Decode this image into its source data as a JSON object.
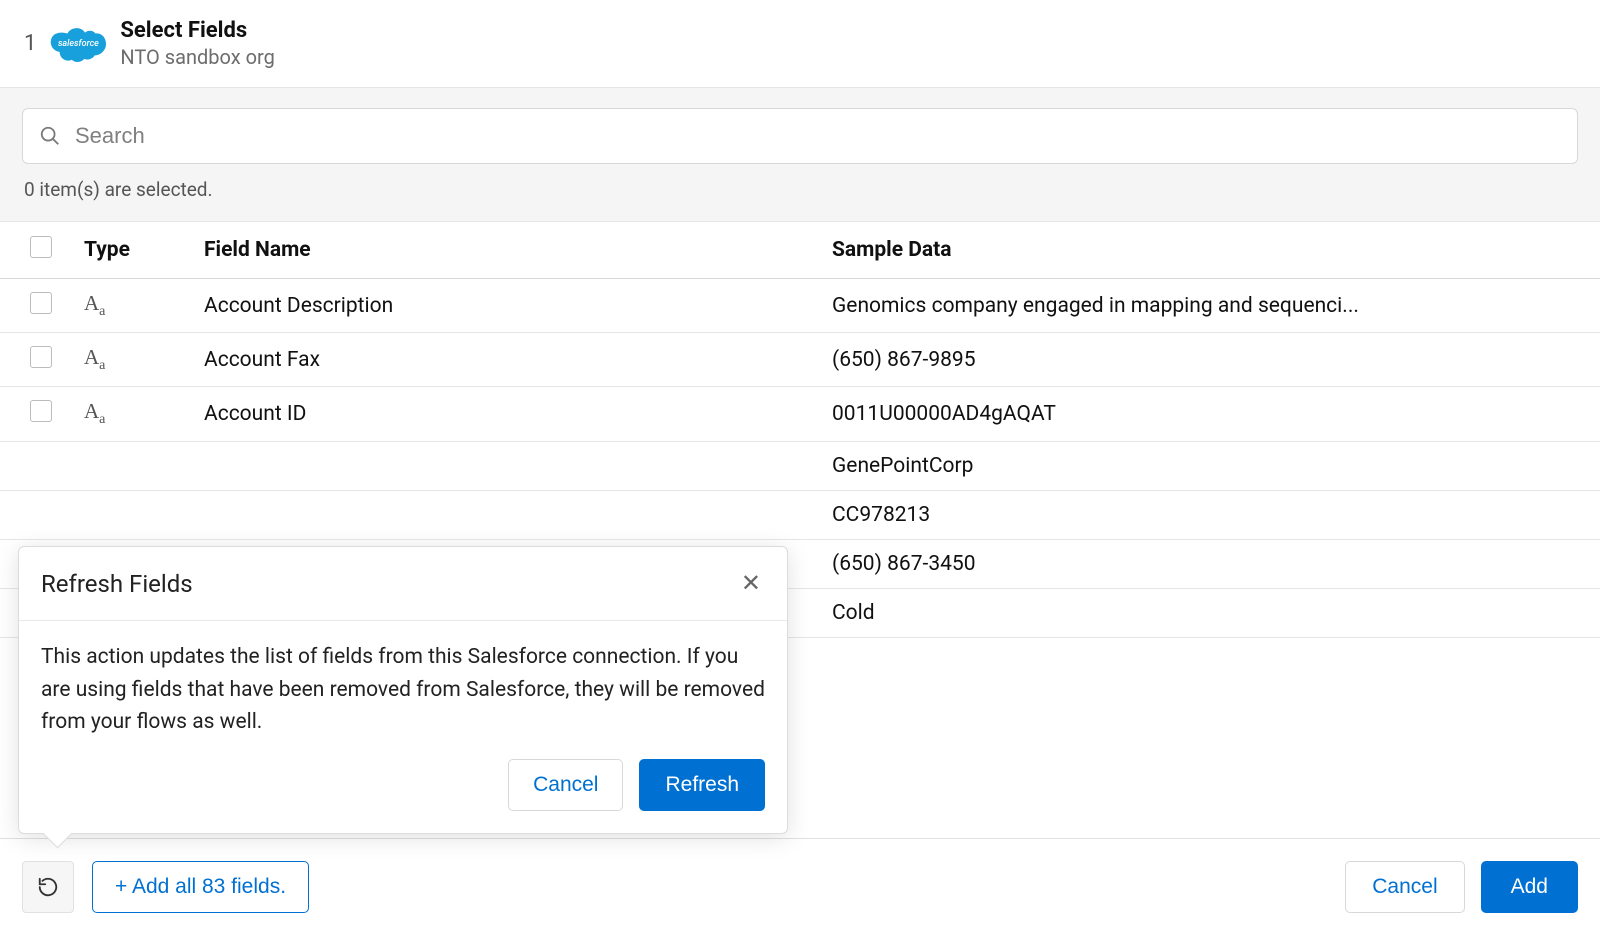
{
  "header": {
    "step_number": "1",
    "title": "Select Fields",
    "subtitle": "NTO sandbox org",
    "cloud_label": "salesforce"
  },
  "search": {
    "placeholder": "Search",
    "selected_text": "0 item(s) are selected."
  },
  "table": {
    "cols": {
      "type": "Type",
      "field_name": "Field Name",
      "sample": "Sample Data"
    },
    "rows": [
      {
        "name": "Account Description",
        "sample": "Genomics company engaged in mapping and sequenci..."
      },
      {
        "name": "Account Fax",
        "sample": "(650) 867-9895"
      },
      {
        "name": "Account ID",
        "sample": "0011U00000AD4gAQAT"
      },
      {
        "name": "",
        "sample": "GenePointCorp"
      },
      {
        "name": "",
        "sample": "CC978213"
      },
      {
        "name": "",
        "sample": "(650) 867-3450"
      },
      {
        "name": "",
        "sample": "Cold"
      }
    ]
  },
  "popover": {
    "title": "Refresh Fields",
    "body": "This action updates the list of fields from this Salesforce connection. If you are using fields that have been removed from Salesforce, they will be removed from your flows as well.",
    "cancel": "Cancel",
    "confirm": "Refresh"
  },
  "footer": {
    "add_all": "+ Add all 83 fields.",
    "cancel": "Cancel",
    "add": "Add"
  }
}
